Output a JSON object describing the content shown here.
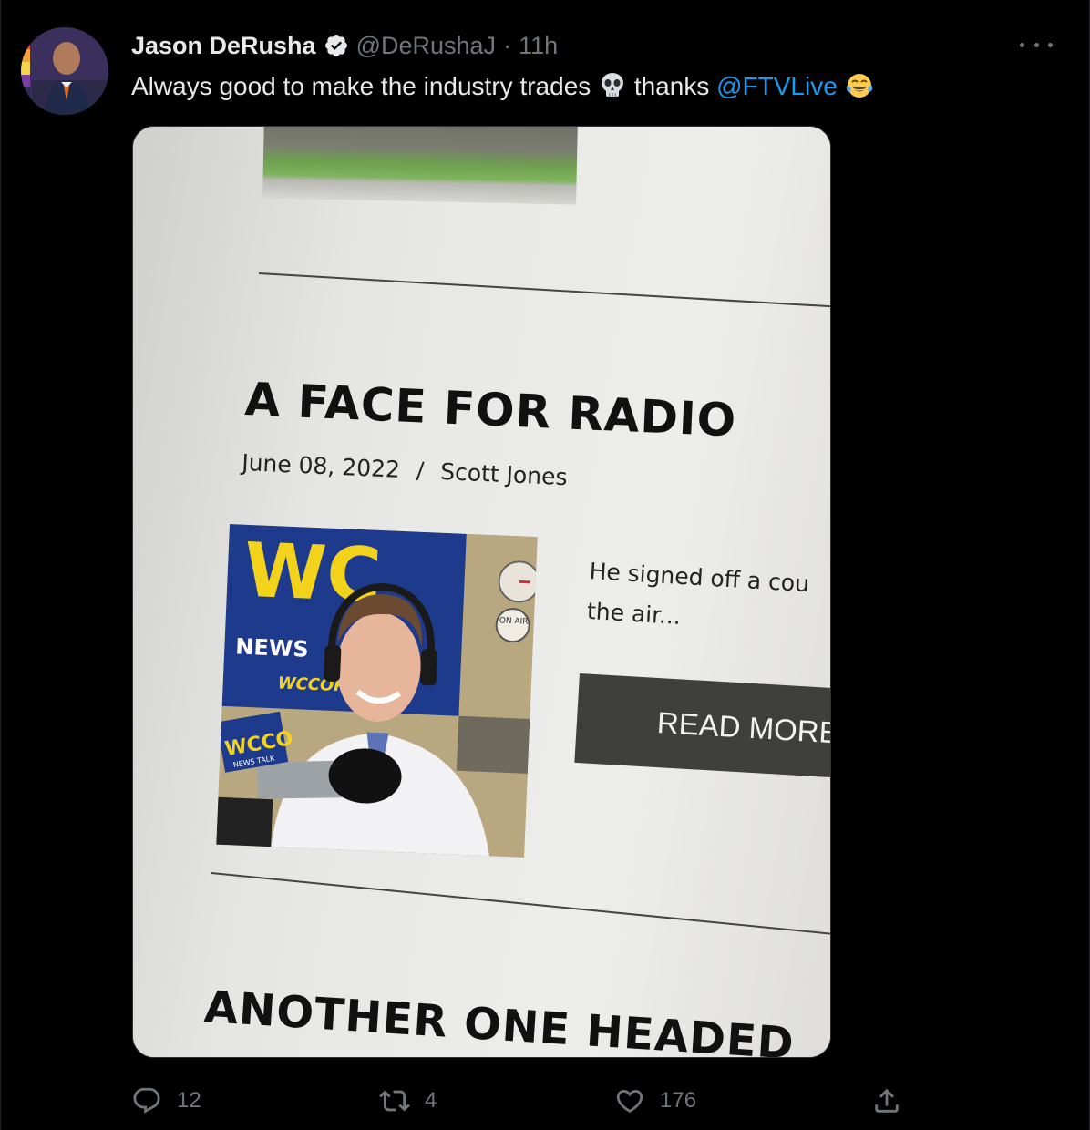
{
  "tweet": {
    "author_name": "Jason DeRusha",
    "handle": "@DeRushaJ",
    "separator": "·",
    "time": "11h",
    "text_part1": "Always good to make the industry trades",
    "text_part2": "thanks",
    "mention": "@FTVLive",
    "emojis": [
      "skull-emoji",
      "tears-of-joy-emoji"
    ]
  },
  "article": {
    "headline": "A FACE FOR RADIO",
    "date": "June 08, 2022",
    "byline_sep": "/",
    "author": "Scott Jones",
    "excerpt_line1": "He signed off a cou",
    "excerpt_line2": "the air...",
    "read_more": "READ MORE",
    "next_headline": "ANOTHER ONE HEADED",
    "photo_signs": {
      "wcco": "WC",
      "news": "NEWS",
      "wccor": "WCCOR",
      "mic_flag": "WCCO",
      "mic_flag_sub": "NEWS TALK",
      "on_air": "ON AIR"
    }
  },
  "actions": {
    "replies": "12",
    "retweets": "4",
    "likes": "176"
  },
  "colors": {
    "background": "#000000",
    "text": "#e7e9ea",
    "muted": "#71767b",
    "link": "#1d9bf0",
    "verified": "#e7e9ea"
  }
}
